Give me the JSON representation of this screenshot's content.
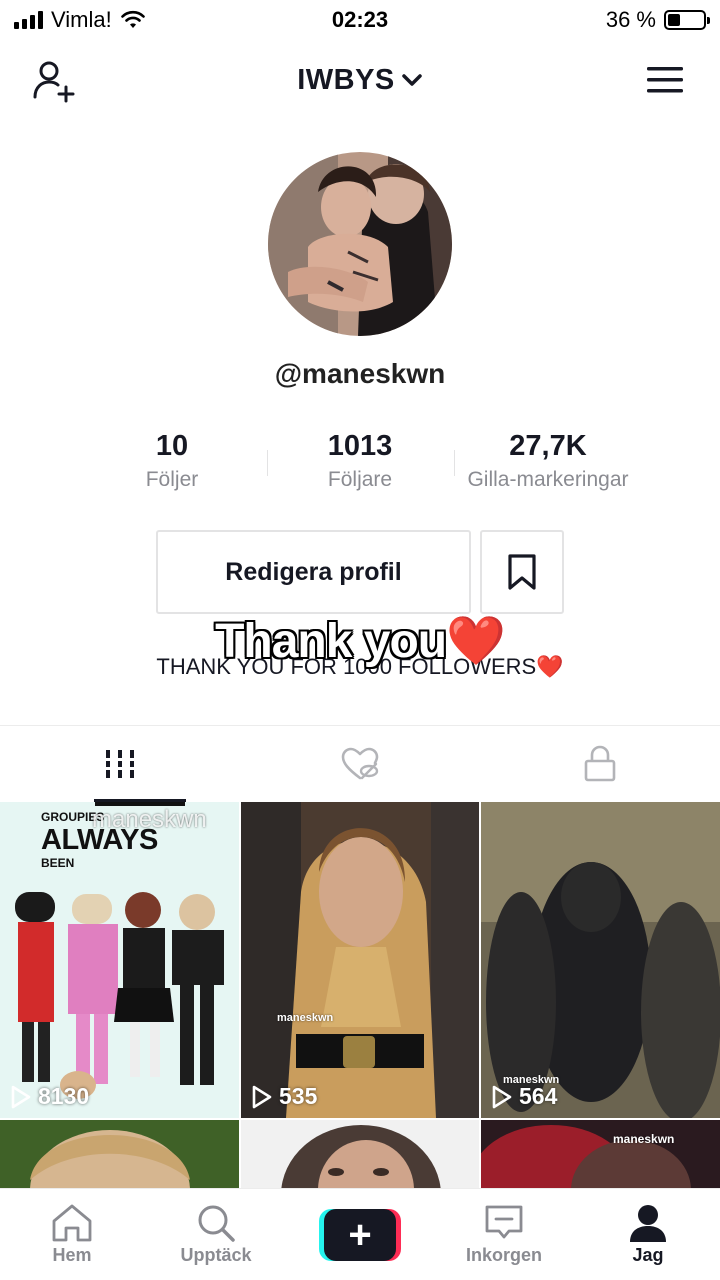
{
  "status_bar": {
    "carrier": "Vimla!",
    "time": "02:23",
    "battery_text": "36 %",
    "battery_level": 0.36
  },
  "header": {
    "title": "IWBYS"
  },
  "profile": {
    "username": "@maneskwn",
    "stats": [
      {
        "value": "10",
        "label": "Följer"
      },
      {
        "value": "1013",
        "label": "Följare"
      },
      {
        "value": "27,7K",
        "label": "Gilla-markeringar"
      }
    ],
    "edit_label": "Redigera profil",
    "overlay_text": "Thank you",
    "overlay_emoji": "❤️",
    "bio_text": "THANK YOU FOR 1000 FOLLOWERS",
    "bio_emoji": "❤️"
  },
  "tabs": [
    {
      "name": "videos",
      "icon": "grid-icon",
      "active": true
    },
    {
      "name": "liked",
      "icon": "liked-hidden-icon",
      "active": false
    },
    {
      "name": "private",
      "icon": "lock-icon",
      "active": false
    }
  ],
  "grid": {
    "videos": [
      {
        "views": "8130",
        "title_top": "GROUPIES",
        "title_main": "ALWAYS",
        "title_sub": "BEEN",
        "watermark": "maneskwn"
      },
      {
        "views": "535",
        "watermark": "maneskwn"
      },
      {
        "views": "564",
        "watermark": "maneskwn"
      },
      {
        "views": ""
      },
      {
        "views": ""
      },
      {
        "views": "",
        "watermark": "maneskwn"
      }
    ]
  },
  "bottom_nav": [
    {
      "label": "Hem",
      "icon": "home-icon"
    },
    {
      "label": "Upptäck",
      "icon": "search-icon"
    },
    {
      "label": "",
      "icon": "plus-icon"
    },
    {
      "label": "Inkorgen",
      "icon": "inbox-icon"
    },
    {
      "label": "Jag",
      "icon": "profile-icon"
    }
  ],
  "colors": {
    "primary_text": "#161823",
    "secondary_text": "#8a8b91",
    "accent_red": "#fe2c55",
    "accent_cyan": "#25f4ee"
  }
}
